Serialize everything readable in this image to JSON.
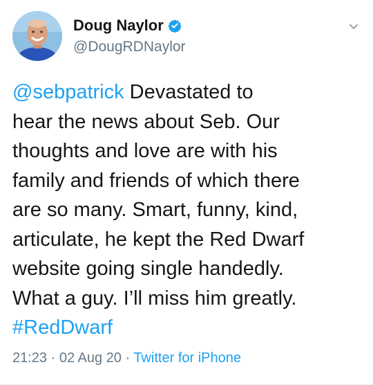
{
  "author": {
    "display_name": "Doug Naylor",
    "handle": "@DougRDNaylor",
    "verified": true,
    "avatar_icon": "profile-photo"
  },
  "tweet": {
    "mention": "@sebpatrick",
    "text_after_mention": " Devastated to\nhear the news about Seb. Our\nthoughts and love are with his\nfamily and friends of which there\nare so many. Smart, funny, kind,\narticulate, he kept the Red Dwarf\nwebsite going single handedly.\nWhat a guy. I’ll miss him greatly.\n",
    "hashtag": "#RedDwarf"
  },
  "meta": {
    "time": "21:23",
    "separator_1": " · ",
    "date": "02 Aug 20",
    "separator_2": " · ",
    "source": "Twitter for iPhone"
  },
  "colors": {
    "link": "#1da1f2",
    "text": "#14171a",
    "secondary": "#657786"
  }
}
